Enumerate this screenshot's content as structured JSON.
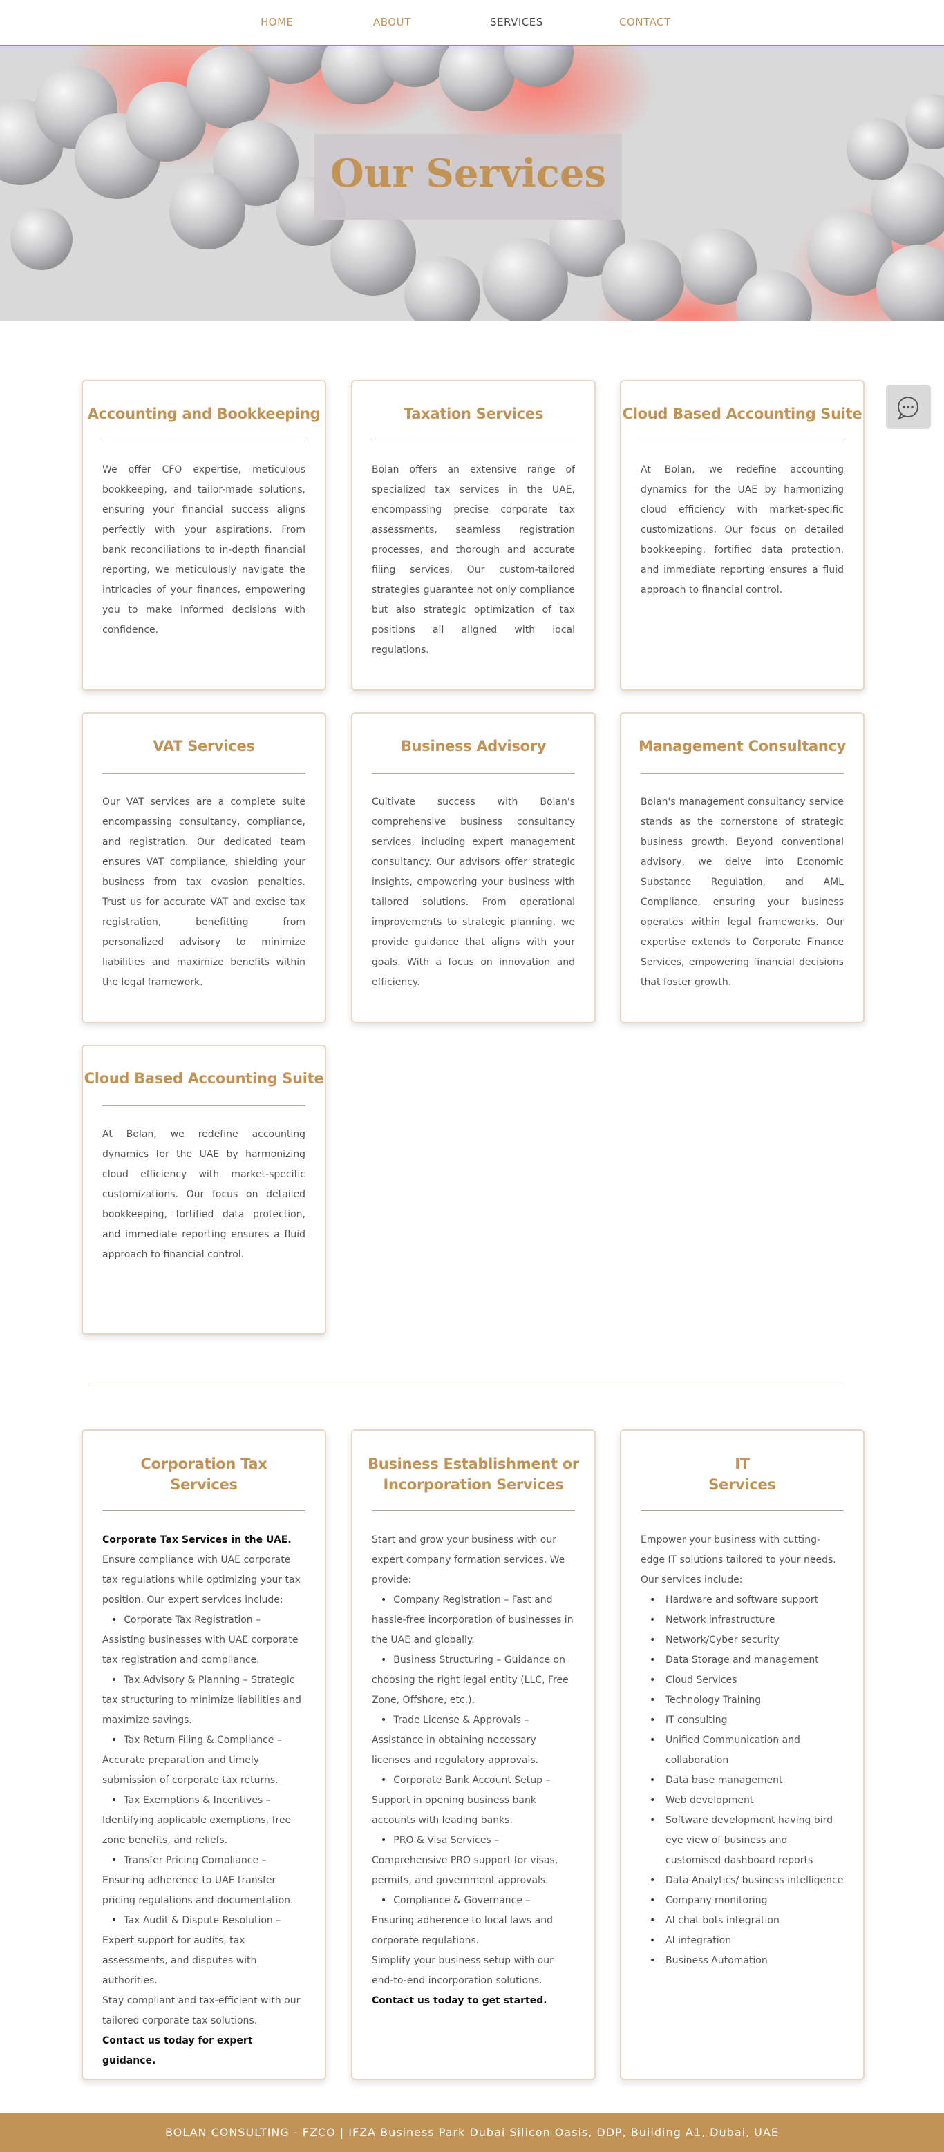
{
  "nav": {
    "items": [
      {
        "label": "HOME"
      },
      {
        "label": "ABOUT"
      },
      {
        "label": "SERVICES"
      },
      {
        "label": "CONTACT"
      }
    ]
  },
  "hero": {
    "title": "Our Services"
  },
  "services": [
    {
      "title": "Accounting and Bookkeeping",
      "text": "We offer CFO expertise, meticulous bookkeeping, and tailor-made solutions, ensuring your financial success aligns perfectly with your aspirations. From bank reconciliations to in-depth financial reporting, we meticulously navigate the intricacies of your finances, empowering you to make informed decisions with confidence."
    },
    {
      "title": "Taxation Services",
      "text": "Bolan offers an extensive range of specialized tax services in the UAE, encompassing precise corporate tax assessments, seamless registration processes, and thorough and accurate filing services. Our custom-tailored strategies guarantee not only compliance but also strategic optimization of tax positions all aligned with local regulations."
    },
    {
      "title": "Cloud Based Accounting Suite",
      "text": "At Bolan, we redefine accounting dynamics for the UAE by harmonizing cloud efficiency with market-specific customizations. Our focus on detailed bookkeeping, fortified data protection, and immediate reporting ensures a fluid approach to financial control."
    },
    {
      "title": "VAT Services",
      "text": "Our VAT services are a complete suite encompassing consultancy, compliance, and registration. Our dedicated team ensures VAT compliance, shielding your business from tax evasion penalties. Trust us for accurate VAT and excise tax registration, benefitting from personalized advisory to minimize liabilities and maximize benefits within the legal framework."
    },
    {
      "title": "Business Advisory",
      "text": "Cultivate success with Bolan's comprehensive business consultancy services, including expert management consultancy. Our advisors offer strategic insights, empowering your business with tailored solutions. From operational improvements to strategic planning, we provide guidance that aligns with your goals. With a focus on innovation and efficiency."
    },
    {
      "title": "Management Consultancy",
      "text": "Bolan's management consultancy service stands as the cornerstone of strategic business growth. Beyond conventional advisory, we delve into Economic Substance Regulation, and AML Compliance, ensuring your business operates within legal frameworks. Our expertise extends to Corporate Finance Services, empowering financial decisions that foster growth."
    },
    {
      "title": "Cloud Based Accounting Suite",
      "text": "At Bolan, we redefine accounting dynamics for the UAE by harmonizing cloud efficiency with market-specific customizations. Our focus on detailed bookkeeping, fortified data protection, and immediate reporting ensures a fluid approach to financial control."
    }
  ],
  "corporation_tax": {
    "title1": "Corporation Tax",
    "title2": "Services",
    "heading": "Corporate Tax Services in the UAE.",
    "intro": "Ensure compliance with UAE corporate tax regulations while optimizing your tax position. Our expert services include:",
    "items": [
      "Corporate Tax Registration – Assisting businesses with UAE corporate tax registration and compliance.",
      "Tax Advisory & Planning – Strategic tax structuring to minimize liabilities and maximize savings.",
      "Tax Return Filing & Compliance – Accurate preparation and timely submission of corporate tax returns.",
      "Tax Exemptions & Incentives – Identifying applicable exemptions, free zone benefits, and reliefs.",
      "Transfer Pricing Compliance – Ensuring adherence to UAE transfer pricing regulations and documentation.",
      "Tax Audit & Dispute Resolution – Expert support for audits, tax assessments, and disputes with authorities."
    ],
    "outro": "Stay compliant and tax-efficient with our tailored corporate tax solutions.",
    "cta": "Contact us today for expert guidance."
  },
  "business_establishment": {
    "title1": "Business Establishment or",
    "title2": "Incorporation Services",
    "intro": "Start and grow your business with our expert company formation services. We provide:",
    "items": [
      "Company Registration – Fast and hassle-free incorporation of businesses in the UAE and globally.",
      "Business Structuring – Guidance on choosing the right legal entity (LLC, Free Zone, Offshore, etc.).",
      "Trade License & Approvals – Assistance in obtaining necessary licenses and regulatory approvals.",
      "Corporate Bank Account Setup – Support in opening business bank accounts with leading banks.",
      "PRO & Visa Services – Comprehensive PRO support for visas, permits, and government approvals.",
      "Compliance & Governance – Ensuring adherence to local laws and corporate regulations."
    ],
    "outro": "Simplify your business setup with our end-to-end incorporation solutions.",
    "cta": "Contact us today to get started."
  },
  "it_services": {
    "title1": "IT",
    "title2": "Services",
    "intro": "Empower your business with cutting-edge IT solutions tailored to your needs. Our services include:",
    "items": [
      "Hardware and software support",
      "Network infrastructure",
      "Network/Cyber security",
      "Data Storage and management",
      "Cloud Services",
      "Technology Training",
      "IT consulting",
      "Unified Communication and collaboration",
      "Data base management",
      "Web development",
      "Software development having bird eye view of business and customised dashboard reports",
      "Data Analytics/ business intelligence",
      "Company monitoring",
      "AI chat bots integration",
      "AI integration",
      "Business Automation"
    ]
  },
  "footer": {
    "text": "BOLAN CONSULTING - FZCO | IFZA Business Park Dubai Silicon Oasis, DDP, Building A1, Dubai, UAE"
  },
  "colors": {
    "accent": "#c29356",
    "card_border": "#ead7c2",
    "footer_bg": "#c29356",
    "hero_bg": "#d9d9da",
    "hero_glow": "#ff8a80"
  },
  "icons": {
    "chat": "chat-bubble-icon"
  }
}
